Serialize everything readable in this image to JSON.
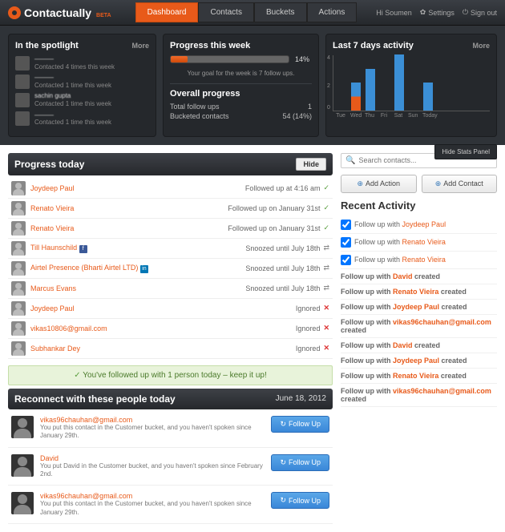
{
  "brand": "Contactually",
  "beta": "BETA",
  "nav": {
    "dashboard": "Dashboard",
    "contacts": "Contacts",
    "buckets": "Buckets",
    "actions": "Actions"
  },
  "header": {
    "greeting": "Hi Soumen",
    "settings": "Settings",
    "signout": "Sign out"
  },
  "spotlight": {
    "title": "In the spotlight",
    "more": "More",
    "items": [
      {
        "name": "———",
        "sub": "Contacted 4 times this week"
      },
      {
        "name": "———",
        "sub": "Contacted 1 time this week"
      },
      {
        "name": "sachin gupta",
        "sub": "Contacted 1 time this week"
      },
      {
        "name": "———",
        "sub": "Contacted 1 time this week"
      }
    ]
  },
  "progress_week": {
    "title": "Progress this week",
    "pct": "14%",
    "pct_val": 14,
    "goal": "Your goal for the week is 7 follow ups."
  },
  "overall": {
    "title": "Overall progress",
    "rows": [
      {
        "label": "Total follow ups",
        "val": "1"
      },
      {
        "label": "Bucketed contacts",
        "val": "54 (14%)"
      }
    ]
  },
  "activity": {
    "title": "Last 7 days activity",
    "more": "More"
  },
  "chart_data": {
    "type": "bar",
    "categories": [
      "Tue",
      "Wed",
      "Thu",
      "Fri",
      "Sat",
      "Sun",
      "Today"
    ],
    "series": [
      {
        "name": "follow-ups",
        "values": [
          0,
          1,
          3,
          0,
          4,
          0,
          2
        ],
        "color": "#3b8fd6"
      },
      {
        "name": "other",
        "values": [
          0,
          1,
          0,
          0,
          0,
          0,
          0
        ],
        "color": "#e85a1a"
      }
    ],
    "ylim": [
      0,
      4
    ],
    "yticks": [
      0,
      2,
      4
    ]
  },
  "hide_stats": "Hide Stats Panel",
  "progress_today": {
    "title": "Progress today",
    "hide": "Hide",
    "rows": [
      {
        "name": "Joydeep Paul",
        "status": "Followed up at 4:16 am",
        "icon": "check"
      },
      {
        "name": "Renato Vieira",
        "status": "Followed up on January 31st",
        "icon": "check"
      },
      {
        "name": "Renato Vieira",
        "status": "Followed up on January 31st",
        "icon": "check"
      },
      {
        "name": "Till Haunschild",
        "social": "f",
        "status": "Snoozed until July 18th",
        "icon": "snooze"
      },
      {
        "name": "Airtel Presence (Bharti Airtel LTD)",
        "social": "in",
        "status": "Snoozed until July 18th",
        "icon": "snooze"
      },
      {
        "name": "Marcus Evans",
        "status": "Snoozed until July 18th",
        "icon": "snooze"
      },
      {
        "name": "Joydeep Paul",
        "status": "Ignored",
        "icon": "x"
      },
      {
        "name": "vikas10806@gmail.com",
        "status": "Ignored",
        "icon": "x"
      },
      {
        "name": "Subhankar Dey",
        "status": "Ignored",
        "icon": "x"
      }
    ],
    "success": "You've followed up with 1 person today – keep it up!"
  },
  "reconnect": {
    "title": "Reconnect with these people today",
    "date": "June 18, 2012",
    "followup_label": "Follow Up",
    "items": [
      {
        "name": "vikas96chauhan@gmail.com",
        "desc": "You put this contact in the Customer bucket, and you haven't spoken since January 29th."
      },
      {
        "name": "David",
        "desc": "You put David in the Customer bucket, and you haven't spoken since February 2nd."
      },
      {
        "name": "vikas96chauhan@gmail.com",
        "desc": "You put this contact in the Customer bucket, and you haven't spoken since January 29th."
      }
    ]
  },
  "sidebar": {
    "search_placeholder": "Search contacts...",
    "add_action": "Add Action",
    "add_contact": "Add Contact",
    "recent_title": "Recent Activity",
    "recent": [
      {
        "check": true,
        "prefix": "Follow up with",
        "name": "Joydeep Paul",
        "suffix": ""
      },
      {
        "check": true,
        "prefix": "Follow up with",
        "name": "Renato Vieira",
        "suffix": ""
      },
      {
        "check": true,
        "prefix": "Follow up with",
        "name": "Renato Vieira",
        "suffix": ""
      },
      {
        "check": false,
        "prefix": "Follow up with",
        "name": "David",
        "suffix": "created"
      },
      {
        "check": false,
        "prefix": "Follow up with",
        "name": "Renato Vieira",
        "suffix": "created"
      },
      {
        "check": false,
        "prefix": "Follow up with",
        "name": "Joydeep Paul",
        "suffix": "created"
      },
      {
        "check": false,
        "prefix": "Follow up with",
        "name": "vikas96chauhan@gmail.com",
        "suffix": "created"
      },
      {
        "check": false,
        "prefix": "Follow up with",
        "name": "David",
        "suffix": "created"
      },
      {
        "check": false,
        "prefix": "Follow up with",
        "name": "Joydeep Paul",
        "suffix": "created"
      },
      {
        "check": false,
        "prefix": "Follow up with",
        "name": "Renato Vieira",
        "suffix": "created"
      },
      {
        "check": false,
        "prefix": "Follow up with",
        "name": "vikas96chauhan@gmail.com",
        "suffix": "created"
      }
    ]
  }
}
